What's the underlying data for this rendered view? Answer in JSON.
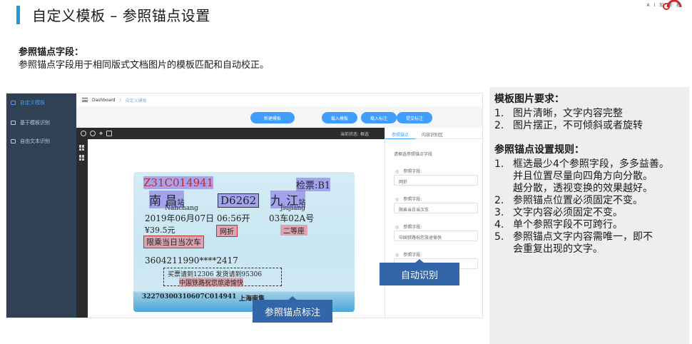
{
  "header": {
    "title": "自定义模板 – 参照锚点设置",
    "logo_text": "A I 加 速 器"
  },
  "section": {
    "heading": "参照锚点字段：",
    "description": "参照锚点字段用于相同版式文档图片的模板匹配和自动校正。"
  },
  "app": {
    "sidebar": {
      "items": [
        {
          "label": "自定义模板",
          "active": true
        },
        {
          "label": "基于模板识别",
          "active": false
        },
        {
          "label": "自由文本识别",
          "active": false
        }
      ]
    },
    "breadcrumb": {
      "home": "Dashboard",
      "separator": "/",
      "current": "自定义模板"
    },
    "buttons": {
      "new_template": "新建模板",
      "load_template": "载入模板",
      "load_annotation": "载入标注",
      "submit_annotation": "提交标注"
    },
    "canvas": {
      "status_label": "当前状态:",
      "status_value": "框选"
    },
    "ticket": {
      "serial": "Z31C014941",
      "check": "检票:B1",
      "from": "南  昌",
      "station_suffix": "站",
      "train": "D6262",
      "to": "九  江",
      "from_pinyin": "Nanchang",
      "to_pinyin": "Jiujiang",
      "datetime": "2019年06月07日 06:56开",
      "seat": "03车02A号",
      "price": "¥39.5元",
      "discount": "网折",
      "seat_class": "二等座",
      "validity": "限乘当日当次车",
      "id_number": "3604211990****2417",
      "notice": "买票请到12306 发货请到95306",
      "slogan": "中国铁路祝您旅途愉快",
      "bottom_code": "32270300310607C014941",
      "bottom_station": "上海南售"
    },
    "panel": {
      "tabs": [
        "参照锚点",
        "内容识别区"
      ],
      "instruction": "请框选参照锚点字段",
      "field_label": "参照字段:",
      "fields": [
        "网折",
        "限乘当日当次车",
        "中国铁路祝您旅途愉快",
        ""
      ]
    },
    "callouts": {
      "auto_recognize": "自动识别",
      "anchor_label": "参照锚点标注"
    }
  },
  "requirements": {
    "template_heading": "模板图片要求：",
    "template_items": [
      {
        "num": "1.",
        "text": "图片清晰，文字内容完整"
      },
      {
        "num": "2.",
        "text": "图片摆正，不可倾斜或者旋转"
      }
    ],
    "anchor_heading": "参照锚点设置规则：",
    "anchor_items": [
      {
        "num": "1.",
        "lines": [
          "框选最少4个参照字段，多多益善。",
          "并且位置尽量向四角方向分散。",
          "越分散，透视变换的效果越好。"
        ]
      },
      {
        "num": "2.",
        "lines": [
          "参照锚点位置必须固定不变。"
        ]
      },
      {
        "num": "3.",
        "lines": [
          "文字内容必须固定不变。"
        ]
      },
      {
        "num": "4.",
        "lines": [
          "单个参照字段不可跨行。"
        ]
      },
      {
        "num": "5.",
        "lines": [
          "参照锚点文字内容需唯一，即不",
          "会重复出现的文字。"
        ]
      }
    ]
  },
  "colors": {
    "accent": "#1d9bd6",
    "sidebar_bg": "#304156",
    "button_blue": "#409eff",
    "callout_blue": "#3366a8",
    "anchor_highlight": "#eb7882",
    "content_highlight": "#7a69e6"
  }
}
